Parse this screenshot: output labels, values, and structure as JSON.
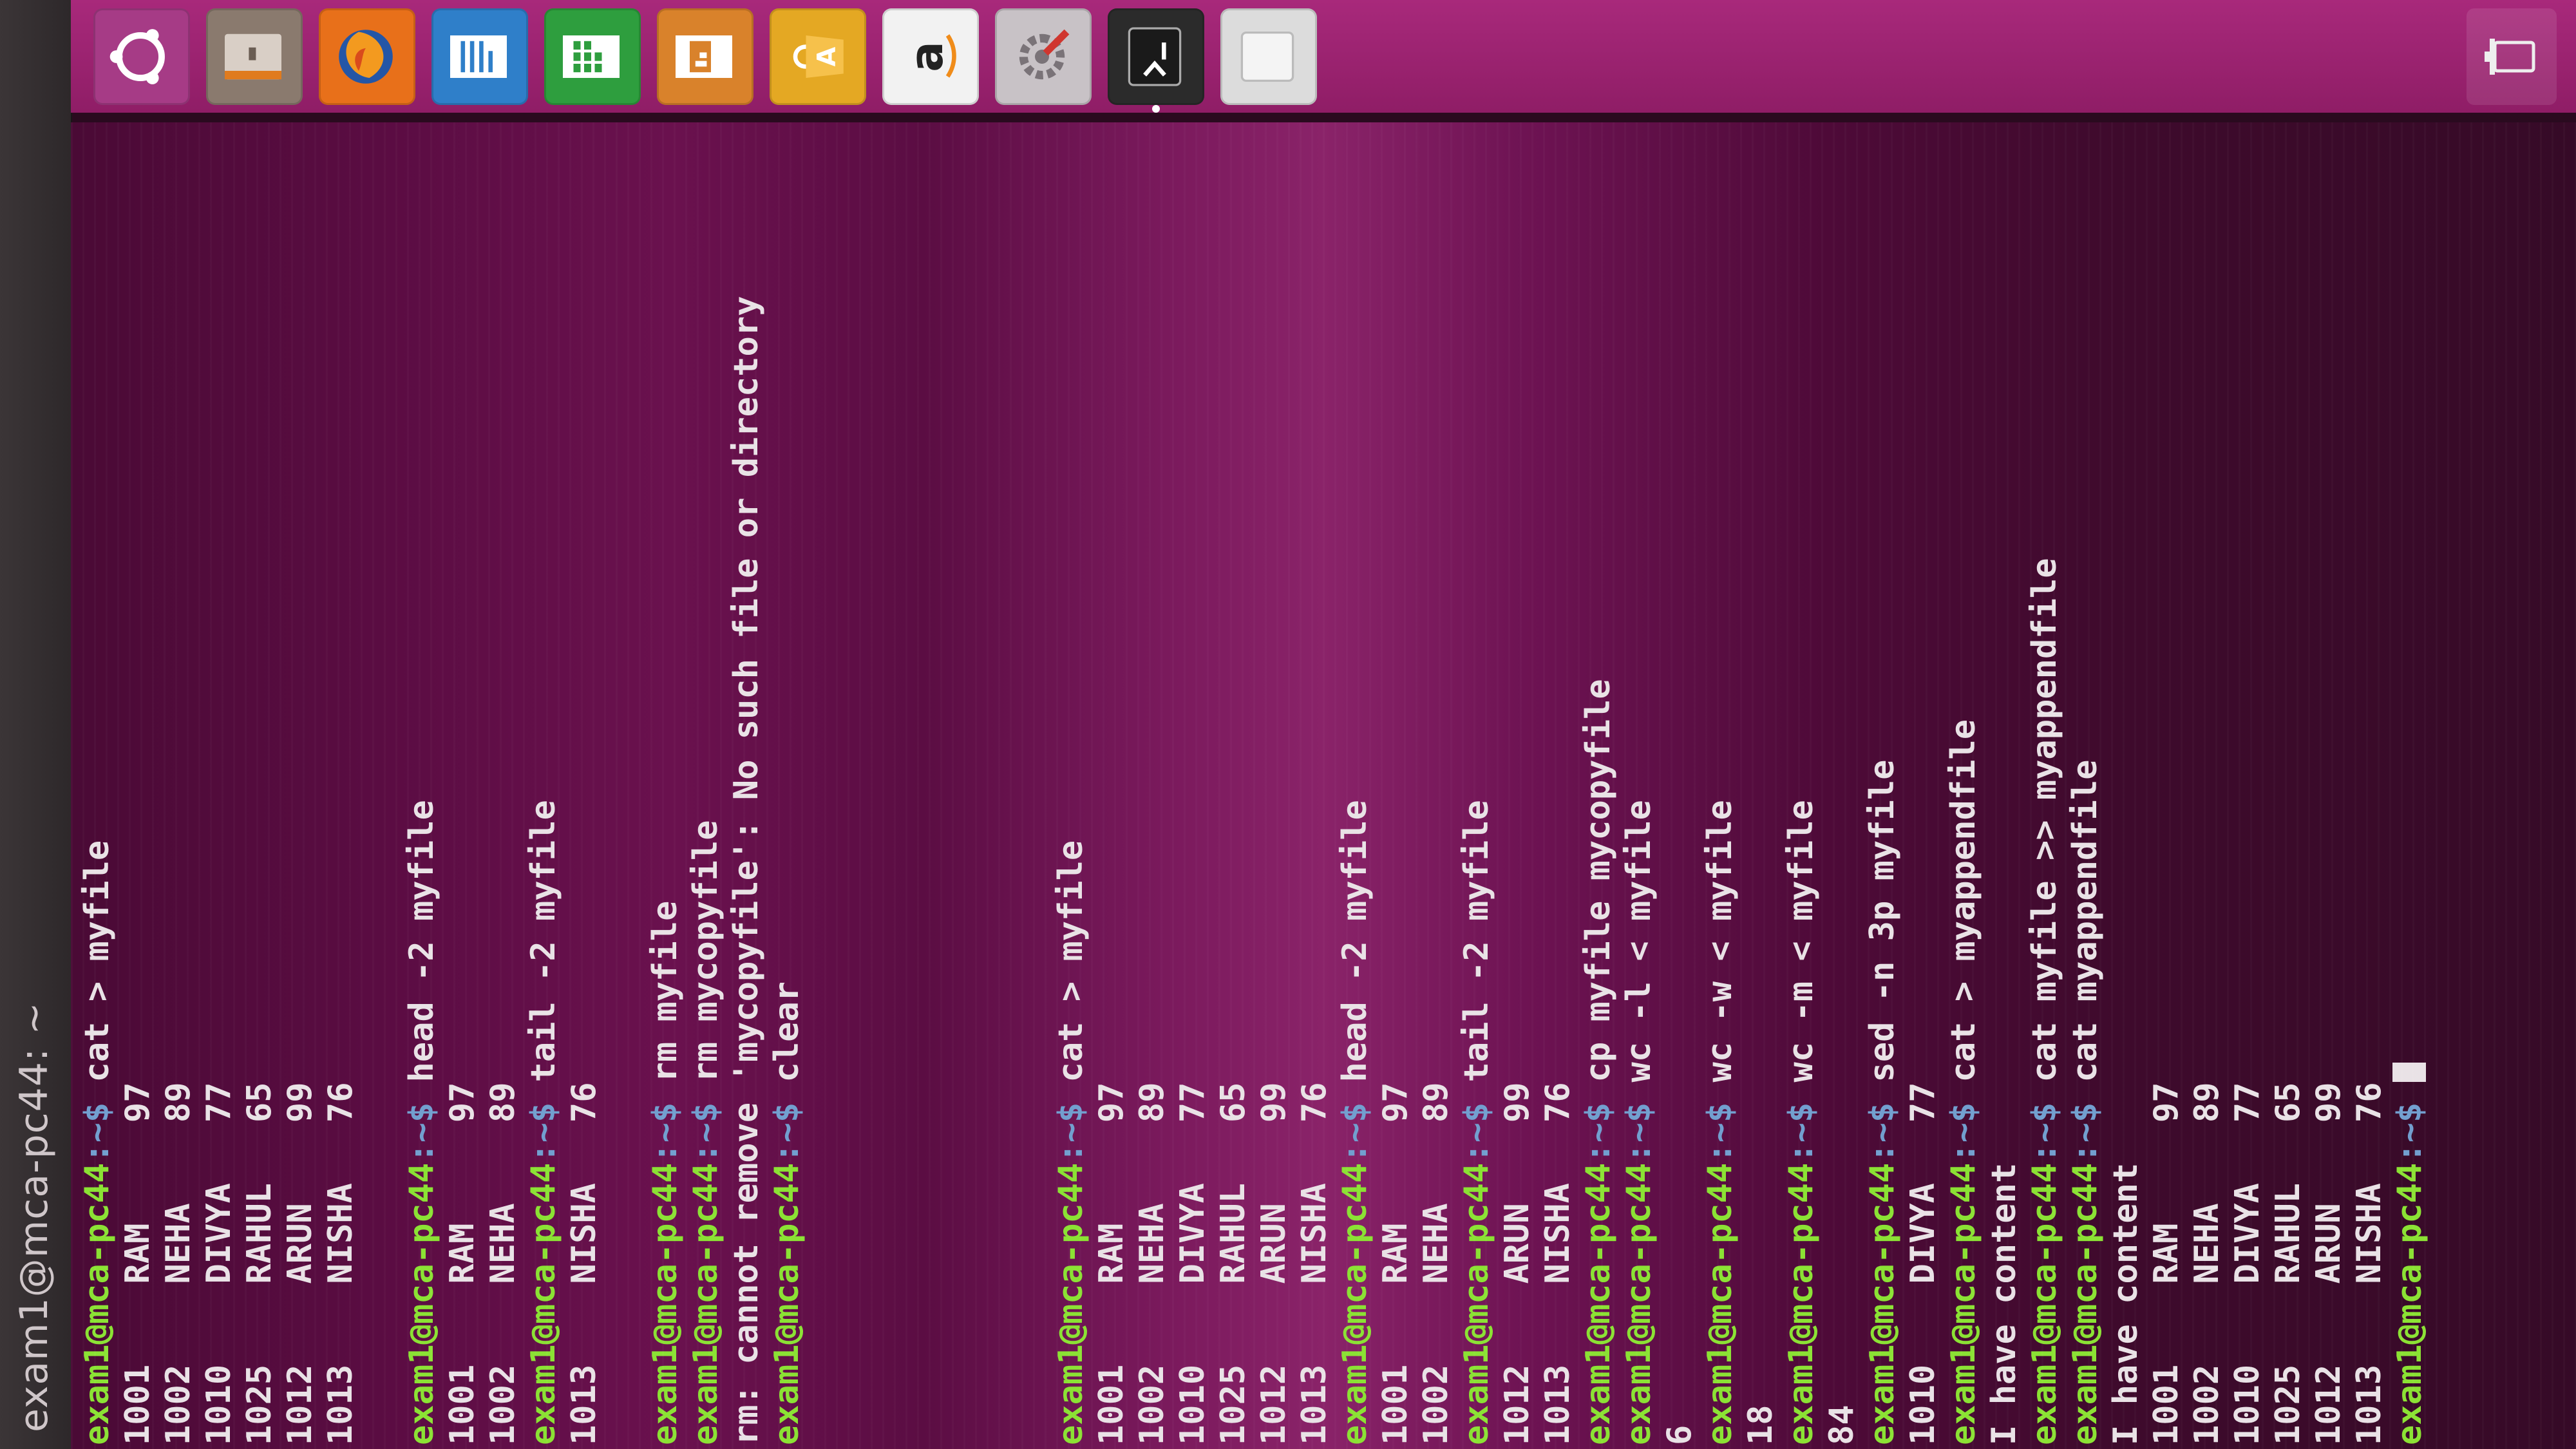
{
  "window": {
    "title": "exam1@mca-pc44: ~"
  },
  "terminal": {
    "prompt_user_host": "exam1@mca-pc44",
    "prompt_path": ":~$",
    "lines": [
      {
        "prompt": true,
        "cmd": " cat > myfile"
      },
      {
        "prompt": false,
        "text": "1001    RAM     97"
      },
      {
        "prompt": false,
        "text": "1002    NEHA    89"
      },
      {
        "prompt": false,
        "text": "1010    DIVYA   77"
      },
      {
        "prompt": false,
        "text": "1025    RAHUL   65"
      },
      {
        "prompt": false,
        "text": "1012    ARUN    99"
      },
      {
        "prompt": false,
        "text": "1013    NISHA   76"
      },
      {
        "prompt": false,
        "text": ""
      },
      {
        "prompt": true,
        "cmd": " head -2 myfile"
      },
      {
        "prompt": false,
        "text": "1001    RAM     97"
      },
      {
        "prompt": false,
        "text": "1002    NEHA    89"
      },
      {
        "prompt": true,
        "cmd": " tail -2 myfile"
      },
      {
        "prompt": false,
        "text": "1013    NISHA   76"
      },
      {
        "prompt": false,
        "text": ""
      },
      {
        "prompt": true,
        "cmd": " rm myfile"
      },
      {
        "prompt": true,
        "cmd": " rm mycopyfile"
      },
      {
        "prompt": false,
        "text": "rm: cannot remove 'mycopyfile': No such file or directory"
      },
      {
        "prompt": true,
        "cmd": " clear"
      },
      {
        "prompt": false,
        "text": ""
      },
      {
        "prompt": false,
        "text": ""
      },
      {
        "prompt": false,
        "text": ""
      },
      {
        "prompt": false,
        "text": ""
      },
      {
        "prompt": false,
        "text": ""
      },
      {
        "prompt": false,
        "text": ""
      },
      {
        "prompt": true,
        "cmd": " cat > myfile"
      },
      {
        "prompt": false,
        "text": "1001    RAM     97"
      },
      {
        "prompt": false,
        "text": "1002    NEHA    89"
      },
      {
        "prompt": false,
        "text": "1010    DIVYA   77"
      },
      {
        "prompt": false,
        "text": "1025    RAHUL   65"
      },
      {
        "prompt": false,
        "text": "1012    ARUN    99"
      },
      {
        "prompt": false,
        "text": "1013    NISHA   76"
      },
      {
        "prompt": true,
        "cmd": " head -2 myfile"
      },
      {
        "prompt": false,
        "text": "1001    RAM     97"
      },
      {
        "prompt": false,
        "text": "1002    NEHA    89"
      },
      {
        "prompt": true,
        "cmd": " tail -2 myfile"
      },
      {
        "prompt": false,
        "text": "1012    ARUN    99"
      },
      {
        "prompt": false,
        "text": "1013    NISHA   76"
      },
      {
        "prompt": true,
        "cmd": " cp myfile mycopyfile"
      },
      {
        "prompt": true,
        "cmd": " wc -l < myfile"
      },
      {
        "prompt": false,
        "text": "6"
      },
      {
        "prompt": true,
        "cmd": " wc -w < myfile"
      },
      {
        "prompt": false,
        "text": "18"
      },
      {
        "prompt": true,
        "cmd": " wc -m < myfile"
      },
      {
        "prompt": false,
        "text": "84"
      },
      {
        "prompt": true,
        "cmd": " sed -n 3p myfile"
      },
      {
        "prompt": false,
        "text": "1010    DIVYA   77"
      },
      {
        "prompt": true,
        "cmd": " cat > myappendfile"
      },
      {
        "prompt": false,
        "text": "I have content"
      },
      {
        "prompt": true,
        "cmd": " cat myfile >> myappendfile"
      },
      {
        "prompt": true,
        "cmd": " cat myappendfile"
      },
      {
        "prompt": false,
        "text": "I have content"
      },
      {
        "prompt": false,
        "text": "1001    RAM     97"
      },
      {
        "prompt": false,
        "text": "1002    NEHA    89"
      },
      {
        "prompt": false,
        "text": "1010    DIVYA   77"
      },
      {
        "prompt": false,
        "text": "1025    RAHUL   65"
      },
      {
        "prompt": false,
        "text": "1012    ARUN    99"
      },
      {
        "prompt": false,
        "text": "1013    NISHA   76"
      },
      {
        "prompt": true,
        "cmd": " ",
        "cursor": true
      }
    ]
  },
  "launcher": {
    "apps": [
      {
        "name": "ubuntu-dash",
        "icon": "ubuntu-logo-icon",
        "bg": "#a63b86"
      },
      {
        "name": "files",
        "icon": "file-cabinet-icon",
        "bg": "#8a7a6e"
      },
      {
        "name": "firefox",
        "icon": "firefox-icon",
        "bg": "#e8701a"
      },
      {
        "name": "libreoffice-writer",
        "icon": "writer-document-icon",
        "bg": "#2f7fc9"
      },
      {
        "name": "libreoffice-calc",
        "icon": "spreadsheet-icon",
        "bg": "#2e9e3e"
      },
      {
        "name": "libreoffice-impress",
        "icon": "presentation-icon",
        "bg": "#d9822b"
      },
      {
        "name": "software-center",
        "icon": "shopping-bag-icon",
        "bg": "#e4a823"
      },
      {
        "name": "amazon",
        "icon": "amazon-icon",
        "bg": "#f2f2f2",
        "label": "a"
      },
      {
        "name": "system-settings",
        "icon": "gear-icon",
        "bg": "#c8c2c6"
      },
      {
        "name": "terminal",
        "icon": "terminal-icon",
        "bg": "#2b2b2b",
        "active": true
      },
      {
        "name": "blank-app",
        "icon": "blank-window-icon",
        "bg": "#dcdcdc"
      }
    ],
    "trash": {
      "icon": "trash-icon"
    }
  }
}
